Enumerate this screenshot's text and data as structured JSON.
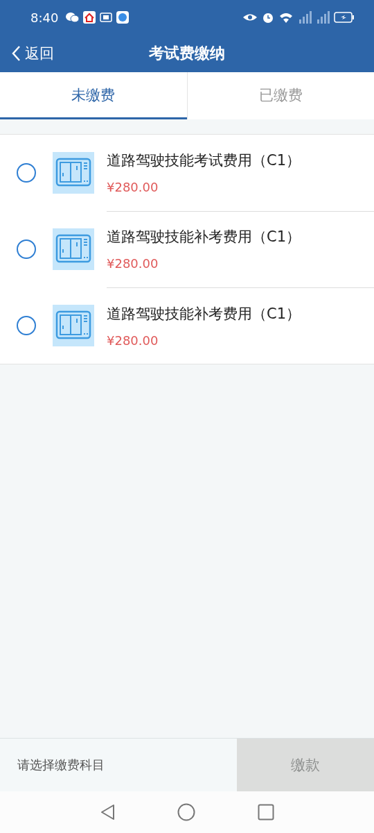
{
  "status_bar": {
    "time": "8:40"
  },
  "header": {
    "back": "返回",
    "title": "考试费缴纳"
  },
  "tabs": [
    {
      "label": "未缴费",
      "selected": true
    },
    {
      "label": "已缴费",
      "selected": false
    }
  ],
  "items": [
    {
      "name": "道路驾驶技能考试费用（C1）",
      "price": "¥280.00",
      "selected": false
    },
    {
      "name": "道路驾驶技能补考费用（C1）",
      "price": "¥280.00",
      "selected": false
    },
    {
      "name": "道路驾驶技能补考费用（C1）",
      "price": "¥280.00",
      "selected": false
    }
  ],
  "footer": {
    "hint": "请选择缴费科目",
    "pay_button": {
      "label": "缴款",
      "disabled": true
    }
  }
}
